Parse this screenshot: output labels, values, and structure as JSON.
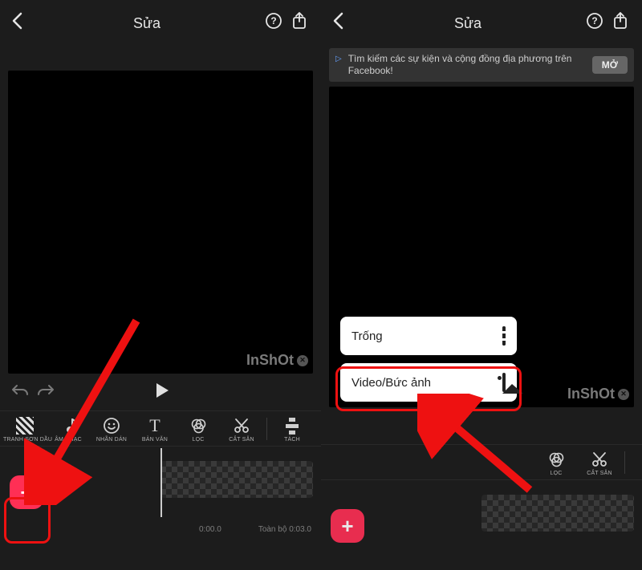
{
  "left": {
    "header": {
      "title": "Sửa"
    },
    "watermark": "InShOt",
    "tools": {
      "canvas": "TRANH SƠN DẦU",
      "music": "ÂM NHẠC",
      "sticker": "NHÃN DÁN",
      "text": "BẢN VĂN",
      "filter": "LỌC",
      "precut": "CẮT SẴN",
      "split": "TÁCH"
    },
    "timeline": {
      "current": "0:00.0",
      "total_prefix": "Toàn bộ",
      "total": "0:03.0"
    }
  },
  "right": {
    "header": {
      "title": "Sửa"
    },
    "ad": {
      "text": "Tìm kiếm các sự kiện và cộng đồng địa phương trên Facebook!",
      "cta": "MỞ"
    },
    "watermark": "InShOt",
    "tools": {
      "filter": "LỌC",
      "precut": "CẮT SẴN"
    },
    "popup": {
      "blank": "Trống",
      "media": "Video/Bức ảnh"
    }
  }
}
